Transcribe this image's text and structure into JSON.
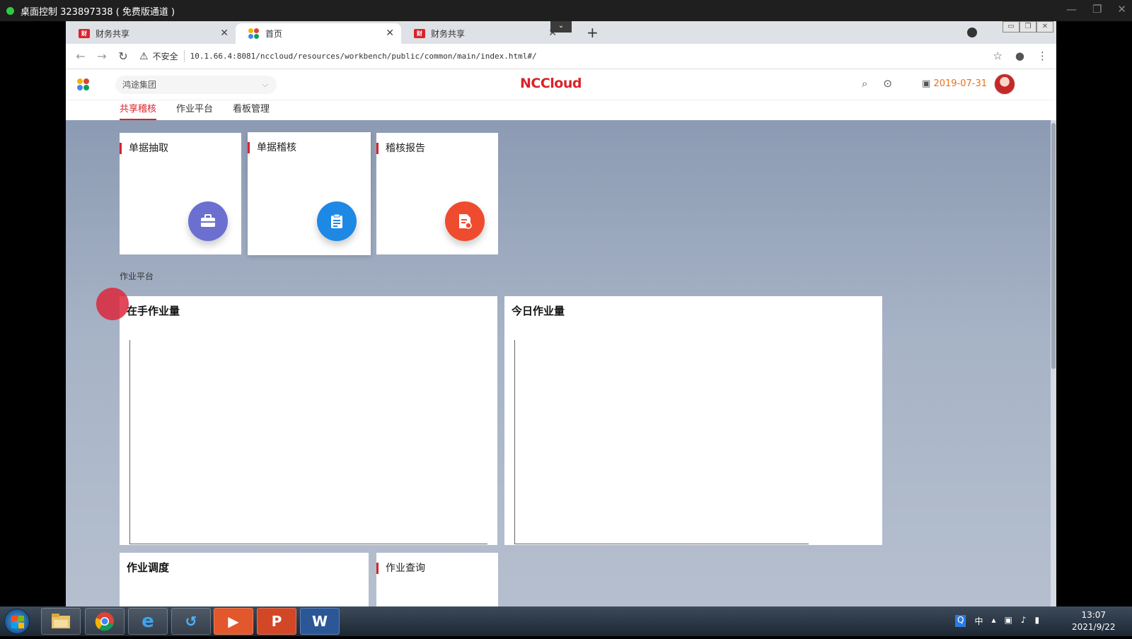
{
  "remote": {
    "title": "桌面控制 323897338 ( 免费版通道 )",
    "controls": [
      "—",
      "❐",
      "✕"
    ]
  },
  "browser": {
    "tabs": [
      {
        "label": "财务共享",
        "close": "✕"
      },
      {
        "label": "首页",
        "close": "✕"
      },
      {
        "label": "财务共享",
        "close": "✕"
      }
    ],
    "new_tab": "+",
    "tab_dropdown": "⌄",
    "insecure_label": "不安全",
    "url": "10.1.66.4:8081/nccloud/resources/workbench/public/common/main/index.html#/"
  },
  "header": {
    "org": "鸿途集团",
    "brand": "NCCloud",
    "date": "2019-07-31"
  },
  "app_tabs": [
    "共享稽核",
    "作业平台",
    "看板管理"
  ],
  "tiles": [
    {
      "name": "单据抽取",
      "icon": "briefcase-icon",
      "color": "#6b6fcf"
    },
    {
      "name": "单据稽核",
      "icon": "clipboard-icon",
      "color": "#1e88e5"
    },
    {
      "name": "稽核报告",
      "icon": "report-icon",
      "color": "#ef4b2e"
    }
  ],
  "section_label": "作业平台",
  "panels": {
    "in_hand": "在手作业量",
    "today": "今日作业量",
    "dispatch": "作业调度",
    "query": "作业查询"
  },
  "taskbar": {
    "apps": [
      "explorer",
      "chrome",
      "ie",
      "app",
      "video",
      "ppt",
      "word"
    ],
    "word_letter": "W",
    "ppt_letter": "P",
    "ime": "中",
    "time": "13:07",
    "date": "2021/9/22"
  },
  "colors": {
    "accent_red": "#d9232b",
    "date_orange": "#e8731d"
  }
}
